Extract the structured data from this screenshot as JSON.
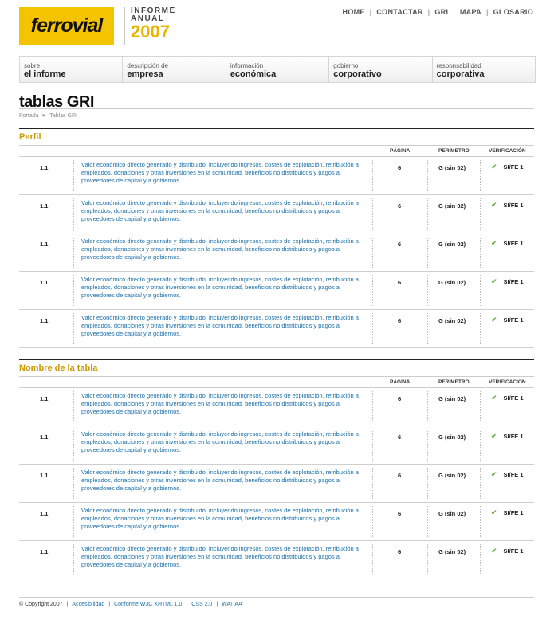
{
  "header": {
    "logo_text": "ferrovial",
    "report_line1": "INFORME",
    "report_line2": "ANUAL",
    "report_year": "2007",
    "top_nav": [
      "HOME",
      "CONTACTAR",
      "GRI",
      "MAPA",
      "GLOSARIO"
    ]
  },
  "menu": [
    {
      "small": "sobre",
      "big": "el informe"
    },
    {
      "small": "descripción de",
      "big": "empresa"
    },
    {
      "small": "información",
      "big": "económica"
    },
    {
      "small": "gobierno",
      "big": "corporativo"
    },
    {
      "small": "responsabilidad",
      "big": "corporativa"
    }
  ],
  "page_title": "tablas GRI",
  "breadcrumb": {
    "home": "Portada",
    "current": "Tablas GRI"
  },
  "columns": {
    "pagina": "PÁGINA",
    "perimetro": "PERÍMETRO",
    "verificacion": "VERIFICACIÓN"
  },
  "sections": [
    {
      "title": "Perfil",
      "rows": [
        {
          "num": "1.1",
          "desc": "Valor económico directo generado y distribuido, incluyendo ingresos, costes de explotación, retribución a empleados, donaciones y otras inversiones en la comunidad, beneficios no distribuidos y pagos a proveedores de capital y a gobiernos.",
          "pagina": "6",
          "perimetro": "G (sin 02)",
          "verificacion": "SI/FE 1"
        },
        {
          "num": "1.1",
          "desc": "Valor económico directo generado y distribuido, incluyendo ingresos, costes de explotación, retribución a empleados, donaciones y otras inversiones en la comunidad, beneficios no distribuidos y pagos a proveedores de capital y a gobiernos.",
          "pagina": "6",
          "perimetro": "G (sin 02)",
          "verificacion": "SI/FE 1"
        },
        {
          "num": "1.1",
          "desc": "Valor económico directo generado y distribuido, incluyendo ingresos, costes de explotación, retribución a empleados, donaciones y otras inversiones en la comunidad, beneficios no distribuidos y pagos a proveedores de capital y a gobiernos.",
          "pagina": "6",
          "perimetro": "G (sin 02)",
          "verificacion": "SI/FE 1"
        },
        {
          "num": "1.1",
          "desc": "Valor económico directo generado y distribuido, incluyendo ingresos, costes de explotación, retribución a empleados, donaciones y otras inversiones en la comunidad, beneficios no distribuidos y pagos a proveedores de capital y a gobiernos.",
          "pagina": "6",
          "perimetro": "G (sin 02)",
          "verificacion": "SI/FE 1"
        },
        {
          "num": "1.1",
          "desc": "Valor económico directo generado y distribuido, incluyendo ingresos, costes de explotación, retribución a empleados, donaciones y otras inversiones en la comunidad, beneficios no distribuidos y pagos a proveedores de capital y a gobiernos.",
          "pagina": "6",
          "perimetro": "G (sin 02)",
          "verificacion": "SI/FE 1"
        }
      ]
    },
    {
      "title": "Nombre de la tabla",
      "rows": [
        {
          "num": "1.1",
          "desc": "Valor económico directo generado y distribuido, incluyendo ingresos, costes de explotación, retribución a empleados, donaciones y otras inversiones en la comunidad, beneficios no distribuidos y pagos a proveedores de capital y a gobiernos.",
          "pagina": "6",
          "perimetro": "G (sin 02)",
          "verificacion": "SI/FE 1"
        },
        {
          "num": "1.1",
          "desc": "Valor económico directo generado y distribuido, incluyendo ingresos, costes de explotación, retribución a empleados, donaciones y otras inversiones en la comunidad, beneficios no distribuidos y pagos a proveedores de capital y a gobiernos.",
          "pagina": "6",
          "perimetro": "G (sin 02)",
          "verificacion": "SI/FE 1"
        },
        {
          "num": "1.1",
          "desc": "Valor económico directo generado y distribuido, incluyendo ingresos, costes de explotación, retribución a empleados, donaciones y otras inversiones en la comunidad, beneficios no distribuidos y pagos a proveedores de capital y a gobiernos.",
          "pagina": "6",
          "perimetro": "G (sin 02)",
          "verificacion": "SI/FE 1"
        },
        {
          "num": "1.1",
          "desc": "Valor económico directo generado y distribuido, incluyendo ingresos, costes de explotación, retribución a empleados, donaciones y otras inversiones en la comunidad, beneficios no distribuidos y pagos a proveedores de capital y a gobiernos.",
          "pagina": "6",
          "perimetro": "G (sin 02)",
          "verificacion": "SI/FE 1"
        },
        {
          "num": "1.1",
          "desc": "Valor económico directo generado y distribuido, incluyendo ingresos, costes de explotación, retribución a empleados, donaciones y otras inversiones en la comunidad, beneficios no distribuidos y pagos a proveedores de capital y a gobiernos.",
          "pagina": "6",
          "perimetro": "G (sin 02)",
          "verificacion": "SI/FE 1"
        }
      ]
    }
  ],
  "footer": {
    "copyright": "© Copyright 2007",
    "links": [
      "Accesibilidad",
      "Conforme  W3C XHTML 1.0",
      "CSS 2.0",
      "WAI 'AA'"
    ]
  },
  "colors": {
    "brand_yellow": "#f5c400",
    "section_title": "#c89a00",
    "link_blue": "#1a6faa",
    "check_green": "#5aa02c"
  },
  "icons": {
    "verified": "check-icon",
    "breadcrumb_separator": "triangle-right-icon"
  }
}
